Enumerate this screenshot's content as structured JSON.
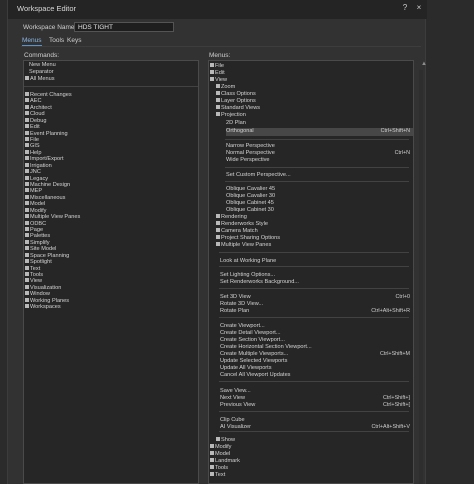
{
  "window": {
    "title": "Workspace Editor",
    "help_icon": "?",
    "close_icon": "×"
  },
  "workspace_name": {
    "label": "Workspace Name:",
    "value": "HDS TIGHT"
  },
  "tabs": [
    "Menus",
    "Tools",
    "Keys"
  ],
  "commands": {
    "label": "Commands:",
    "top_items": [
      "New Menu",
      "Separator",
      "All Menus"
    ],
    "categories": [
      "Recent Changes",
      "AEC",
      "Architect",
      "Cloud",
      "Debug",
      "Edit",
      "Event Planning",
      "File",
      "GIS",
      "Help",
      "Import/Export",
      "Irrigation",
      "JNC",
      "Legacy",
      "Machine Design",
      "MEP",
      "Miscellaneous",
      "Model",
      "Modify",
      "Multiple View Panes",
      "ODBC",
      "Page",
      "Palettes",
      "Simplify",
      "Site Model",
      "Space Planning",
      "Spotlight",
      "Text",
      "Tools",
      "View",
      "Visualization",
      "Window",
      "Working Planes",
      "Workspaces"
    ]
  },
  "menus": {
    "label": "Menus:",
    "scroll_up_icon": "▲",
    "items": [
      {
        "label": "File",
        "shortcut": ""
      },
      {
        "label": "Edit",
        "shortcut": ""
      },
      {
        "label": "View",
        "shortcut": ""
      },
      {
        "label": "Zoom",
        "shortcut": ""
      },
      {
        "label": "Class Options",
        "shortcut": ""
      },
      {
        "label": "Layer Options",
        "shortcut": ""
      },
      {
        "label": "Standard Views",
        "shortcut": ""
      },
      {
        "label": "Projection",
        "shortcut": ""
      },
      {
        "label": "2D Plan",
        "shortcut": ""
      },
      {
        "label": "Orthogonal",
        "shortcut": "Ctrl+Shift+N"
      },
      {
        "label": "Narrow Perspective",
        "shortcut": ""
      },
      {
        "label": "Normal Perspective",
        "shortcut": "Ctrl+N"
      },
      {
        "label": "Wide Perspective",
        "shortcut": ""
      },
      {
        "label": "Set Custom Perspective...",
        "shortcut": ""
      },
      {
        "label": "Oblique Cavalier 45",
        "shortcut": ""
      },
      {
        "label": "Oblique Cavalier 30",
        "shortcut": ""
      },
      {
        "label": "Oblique Cabinet 45",
        "shortcut": ""
      },
      {
        "label": "Oblique Cabinet 30",
        "shortcut": ""
      },
      {
        "label": "Rendering",
        "shortcut": ""
      },
      {
        "label": "Renderworks Style",
        "shortcut": ""
      },
      {
        "label": "Camera Match",
        "shortcut": ""
      },
      {
        "label": "Project Sharing Options",
        "shortcut": ""
      },
      {
        "label": "Multiple View Panes",
        "shortcut": ""
      },
      {
        "label": "Look at Working Plane",
        "shortcut": ""
      },
      {
        "label": "Set Lighting Options...",
        "shortcut": ""
      },
      {
        "label": "Set Renderworks Background...",
        "shortcut": ""
      },
      {
        "label": "Set 3D View",
        "shortcut": "Ctrl+0"
      },
      {
        "label": "Rotate 3D View...",
        "shortcut": ""
      },
      {
        "label": "Rotate Plan",
        "shortcut": "Ctrl+Alt+Shift+R"
      },
      {
        "label": "Create Viewport...",
        "shortcut": ""
      },
      {
        "label": "Create Detail Viewport...",
        "shortcut": ""
      },
      {
        "label": "Create Section Viewport...",
        "shortcut": ""
      },
      {
        "label": "Create Horizontal Section Viewport...",
        "shortcut": ""
      },
      {
        "label": "Create Multiple Viewports...",
        "shortcut": "Ctrl+Shift+M"
      },
      {
        "label": "Update Selected Viewports",
        "shortcut": ""
      },
      {
        "label": "Update All Viewports",
        "shortcut": ""
      },
      {
        "label": "Cancel All Viewport Updates",
        "shortcut": ""
      },
      {
        "label": "Save View...",
        "shortcut": ""
      },
      {
        "label": "Next View",
        "shortcut": "Ctrl+Shift+]"
      },
      {
        "label": "Previous View",
        "shortcut": "Ctrl+Shift+["
      },
      {
        "label": "Clip Cube",
        "shortcut": ""
      },
      {
        "label": "AI Visualizer",
        "shortcut": "Ctrl+Alt+Shift+V"
      },
      {
        "label": "Show",
        "shortcut": ""
      },
      {
        "label": "Modify",
        "shortcut": ""
      },
      {
        "label": "Model",
        "shortcut": ""
      },
      {
        "label": "Landmark",
        "shortcut": ""
      },
      {
        "label": "Tools",
        "shortcut": ""
      },
      {
        "label": "Text",
        "shortcut": ""
      }
    ]
  }
}
